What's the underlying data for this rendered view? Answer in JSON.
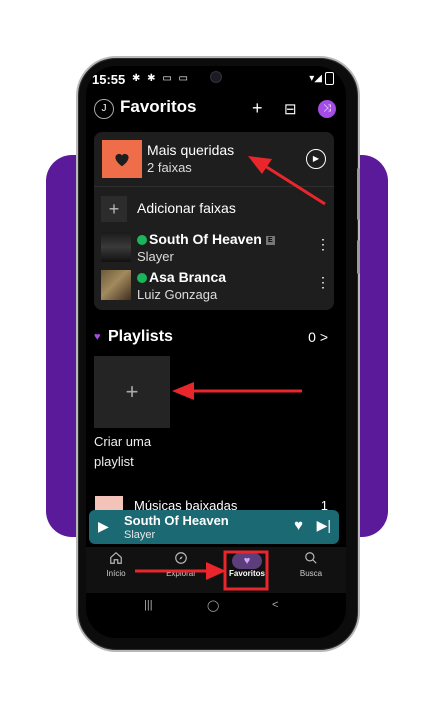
{
  "status": {
    "time": "15:55",
    "notif_icons": "✱ ✱ ▭ ▭",
    "signal": "▾◢"
  },
  "header": {
    "avatar_initial": "J",
    "title": "Favoritos",
    "add_icon": "+",
    "layout_icon": "⊟",
    "shuffle_icon": "⤨"
  },
  "favorites": {
    "title": "Mais queridas",
    "subtitle": "2 faixas",
    "play_icon": "▶",
    "add_label": "Adicionar faixas",
    "tracks": [
      {
        "title": "South Of Heaven",
        "artist": "Slayer",
        "explicit": "E"
      },
      {
        "title": "Asa Branca",
        "artist": "Luiz Gonzaga"
      }
    ]
  },
  "playlists": {
    "title": "Playlists",
    "count": "0",
    "chevron": ">",
    "create_label": "Criar uma playlist"
  },
  "downloads": {
    "label": "Músicas baixadas",
    "count": "1"
  },
  "mini_player": {
    "title": "South Of Heaven",
    "artist": "Slayer"
  },
  "nav": [
    {
      "label": "Início",
      "icon": "home-icon"
    },
    {
      "label": "Explorar",
      "icon": "compass-icon"
    },
    {
      "label": "Favoritos",
      "icon": "heart-icon"
    },
    {
      "label": "Busca",
      "icon": "search-icon"
    }
  ],
  "colors": {
    "accent_purple": "#a34ce6",
    "heart_tile": "#f06d4a",
    "mini_player": "#1b6a73",
    "annotation_red": "#e8262b",
    "backdrop": "#5b1a9a"
  }
}
